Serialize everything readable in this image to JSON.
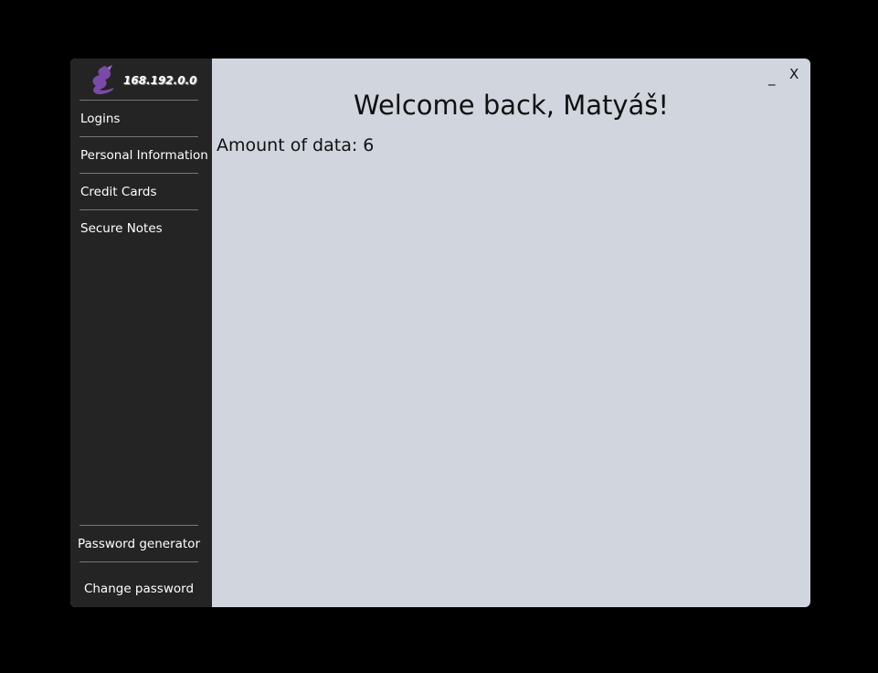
{
  "logo": {
    "text": "168.192.0.0",
    "icon": "dragon-icon"
  },
  "sidebar": {
    "items": [
      {
        "label": "Logins"
      },
      {
        "label": "Personal Information"
      },
      {
        "label": "Credit Cards"
      },
      {
        "label": "Secure Notes"
      }
    ],
    "bottom": [
      {
        "label": "Password generator"
      },
      {
        "label": "Change password"
      }
    ]
  },
  "window": {
    "minimize": "_",
    "close": "X"
  },
  "main": {
    "title": "Welcome back, Matyáš!",
    "amount": "Amount of data: 6"
  }
}
